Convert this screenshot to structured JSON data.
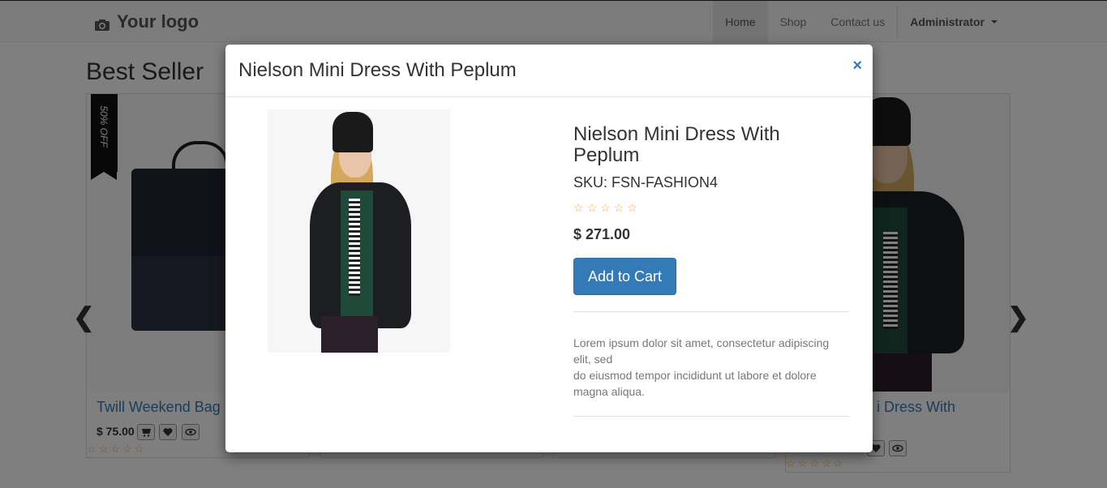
{
  "navbar": {
    "logo_text": "Your logo",
    "links": [
      "Home",
      "Shop",
      "Contact us"
    ],
    "user_label": "Administrator"
  },
  "page": {
    "section_title": "Best Seller",
    "prev_arrow": "❮",
    "next_arrow": "❯"
  },
  "cards": [
    {
      "badge": "50% OFF",
      "name": "Twill Weekend Bag",
      "price": "$ 75.00"
    },
    {
      "name_partial": "i Dress With"
    }
  ],
  "modal": {
    "title": "Nielson Mini Dress With Peplum",
    "close_icon": "×",
    "product_name": "Nielson Mini Dress With Peplum",
    "sku": "SKU: FSN-FASHION4",
    "rating_stars": 0,
    "price": "$ 271.00",
    "add_to_cart_label": "Add to Cart",
    "description_lines": [
      "Lorem ipsum dolor sit amet, consectetur adipiscing elit, sed",
      "do eiusmod tempor incididunt ut labore et dolore magna aliqua."
    ]
  },
  "colors": {
    "primary": "#337ab7",
    "star": "#f0ad4e",
    "overlay": "rgba(0,0,0,0.5)"
  }
}
